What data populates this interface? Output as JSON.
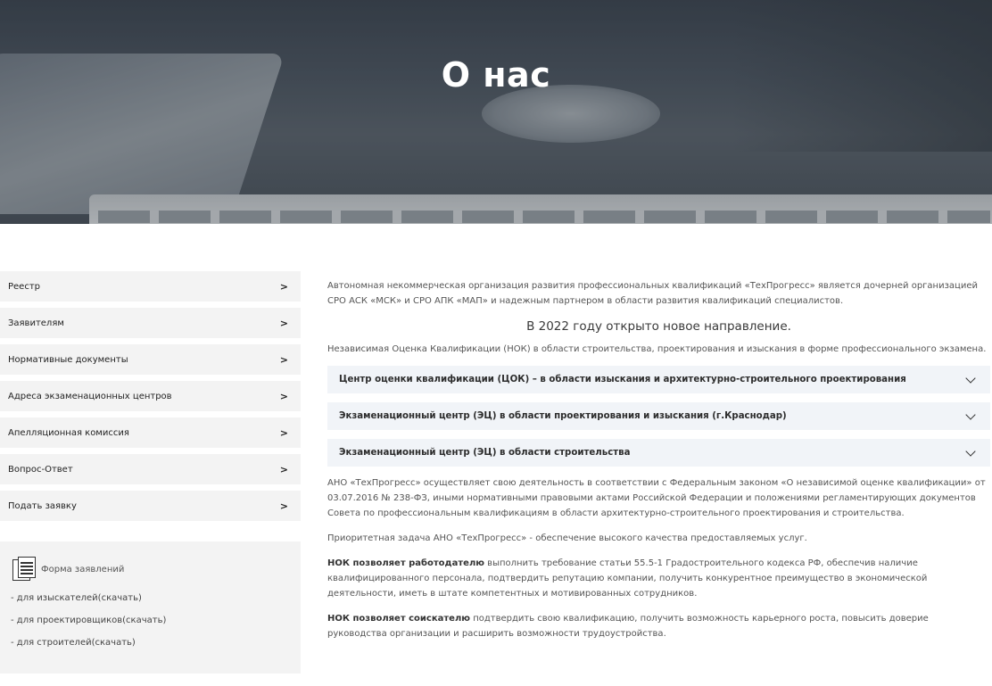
{
  "hero": {
    "title": "О нас"
  },
  "sidebar": {
    "items": [
      {
        "label": "Реестр"
      },
      {
        "label": "Заявителям"
      },
      {
        "label": "Нормативные документы"
      },
      {
        "label": "Адреса экзаменационных центров"
      },
      {
        "label": "Апелляционная комиссия"
      },
      {
        "label": "Вопрос-Ответ"
      },
      {
        "label": "Подать заявку"
      }
    ],
    "chevron": ">"
  },
  "forms": {
    "title": "Форма заявлений",
    "icon": "document-stack-icon",
    "links": [
      {
        "label": "- для изыскателей(скачать)"
      },
      {
        "label": "- для проектировщиков(скачать)"
      },
      {
        "label": "- для строителей(скачать)"
      }
    ]
  },
  "main": {
    "intro": "Автономная некоммерческая организация развития профессиональных квалификаций «ТехПрогресс» является дочерней организацией СРО АСК «МСК» и СРО АПК «МАП» и надежным партнером в области развития квалификаций специалистов.",
    "headline": "В 2022 году открыто новое направление.",
    "nok_text": "Независимая Оценка Квалификации (НОК) в области строительства, проектирования и изыскания в форме профессионального экзамена.",
    "accordion": [
      {
        "label": "Центр оценки квалификации (ЦОК) – в области изыскания и архитектурно-строительного проектирования"
      },
      {
        "label": "Экзаменационный центр (ЭЦ) в области проектирования и изыскания (г.Краснодар)"
      },
      {
        "label": "Экзаменационный центр (ЭЦ) в области строительства"
      }
    ],
    "law_text": "АНО «ТехПрогресс» осуществляет свою деятельность в соответствии с Федеральным законом «О независимой оценке квалификации» от 03.07.2016 № 238-ФЗ, иными нормативными правовыми актами Российской Федерации и положениями регламентирующих документов Совета по профессиональным квалификациям в области архитектурно-строительного проектирования и строительства.",
    "priority_text": "Приоритетная задача АНО «ТехПрогресс» - обеспечение высокого качества предоставляемых услуг.",
    "employer_bold": "НОК позволяет работодателю",
    "employer_text": " выполнить требование статьи 55.5-1 Градостроительного кодекса РФ, обеспечив наличие квалифицированного персонала, подтвердить репутацию компании, получить конкурентное преимущество в экономической деятельности, иметь в штате компетентных и мотивированных сотрудников.",
    "applicant_bold": "НОК позволяет соискателю",
    "applicant_text": " подтвердить свою квалификацию, получить возможность карьерного роста, повысить доверие руководства организации и расширить возможности трудоустройства."
  }
}
